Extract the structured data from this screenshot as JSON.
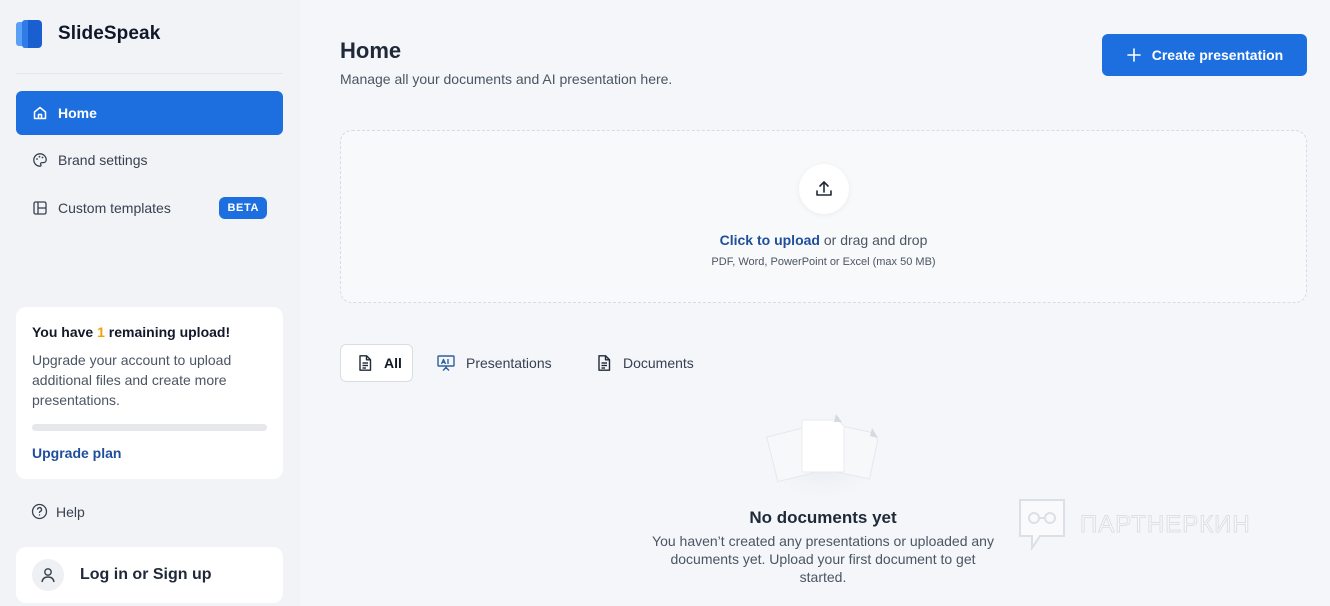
{
  "app": {
    "name": "SlideSpeak",
    "brand_color": "#1d6fe0"
  },
  "sidebar": {
    "nav": [
      {
        "label": "Home",
        "icon": "home-icon",
        "active": true
      },
      {
        "label": "Brand settings",
        "icon": "palette-icon",
        "active": false
      },
      {
        "label": "Custom templates",
        "icon": "template-icon",
        "active": false,
        "badge": "BETA"
      }
    ],
    "upload_card": {
      "title_prefix": "You have ",
      "remaining_count": "1",
      "title_suffix": " remaining upload!",
      "description": "Upgrade your account to upload additional files and create more presentations.",
      "progress": 0,
      "upgrade_label": "Upgrade plan"
    },
    "help_label": "Help",
    "login_label": "Log in or Sign up"
  },
  "main": {
    "title": "Home",
    "subtitle": "Manage all your documents and AI presentation here.",
    "create_button_label": "Create presentation",
    "dropzone": {
      "click_label": "Click to upload",
      "rest_label": " or drag and drop",
      "hint": "PDF, Word, PowerPoint or Excel (max 50 MB)"
    },
    "tabs": [
      {
        "label": "All",
        "icon": "document-icon",
        "active": true
      },
      {
        "label": "Presentations",
        "icon": "presentation-icon",
        "active": false
      },
      {
        "label": "Documents",
        "icon": "document-icon",
        "active": false
      }
    ],
    "empty_state": {
      "title": "No documents yet",
      "description": "You haven’t created any presentations or uploaded any documents yet. Upload your first document to get started."
    }
  },
  "watermark": {
    "text": "ПАРТНЕРКИН"
  }
}
